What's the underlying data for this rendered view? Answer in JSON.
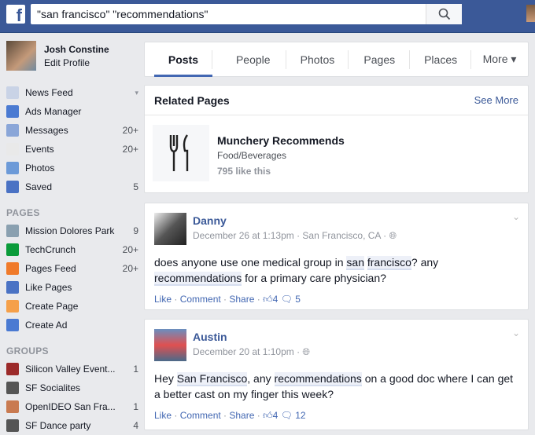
{
  "header": {
    "search_value": "\"san francisco\" \"recommendations\"",
    "logo": "f"
  },
  "profile": {
    "name": "Josh Constine",
    "edit": "Edit Profile"
  },
  "nav": [
    {
      "label": "News Feed",
      "count": "",
      "icon": "news-feed-icon",
      "color": "#c9d3e6"
    },
    {
      "label": "Ads Manager",
      "count": "",
      "icon": "ads-manager-icon",
      "color": "#4a7ad2"
    },
    {
      "label": "Messages",
      "count": "20+",
      "icon": "messages-icon",
      "color": "#8aa6d8"
    },
    {
      "label": "Events",
      "count": "20+",
      "icon": "events-icon",
      "color": "#e9e9e9"
    },
    {
      "label": "Photos",
      "count": "",
      "icon": "photos-icon",
      "color": "#6c9ad8"
    },
    {
      "label": "Saved",
      "count": "5",
      "icon": "saved-icon",
      "color": "#4a72c4"
    }
  ],
  "pages_heading": "PAGES",
  "pages": [
    {
      "label": "Mission Dolores Park",
      "count": "9",
      "color": "#8aa0b0"
    },
    {
      "label": "TechCrunch",
      "count": "20+",
      "color": "#0a9b3a"
    },
    {
      "label": "Pages Feed",
      "count": "20+",
      "color": "#f07a2a"
    },
    {
      "label": "Like Pages",
      "count": "",
      "color": "#4a72c4"
    },
    {
      "label": "Create Page",
      "count": "",
      "color": "#f5a04a"
    },
    {
      "label": "Create Ad",
      "count": "",
      "color": "#4a7ad2"
    }
  ],
  "groups_heading": "GROUPS",
  "groups": [
    {
      "label": "Silicon Valley Event...",
      "count": "1",
      "color": "#9b2a2a"
    },
    {
      "label": "SF Socialites",
      "count": "",
      "color": "#555"
    },
    {
      "label": "OpenIDEO San Fra...",
      "count": "1",
      "color": "#c97a50"
    },
    {
      "label": "SF Dance party",
      "count": "4",
      "color": "#555"
    }
  ],
  "tabs": [
    "Posts",
    "People",
    "Photos",
    "Pages",
    "Places",
    "More ▾"
  ],
  "related": {
    "title": "Related Pages",
    "see_more": "See More",
    "name": "Munchery Recommends",
    "category": "Food/Beverages",
    "likes": "795 like this"
  },
  "posts": [
    {
      "author": "Danny",
      "meta": "December 26 at 1:13pm · San Francisco, CA · ",
      "text": [
        "does anyone use one medical group in ",
        "san",
        " ",
        "francisco",
        "? any ",
        "recommendations",
        " for a primary care physician?"
      ],
      "likes": "4",
      "comments": "5"
    },
    {
      "author": "Austin",
      "meta": "December 20 at 1:10pm · ",
      "text": [
        "Hey ",
        "San Francisco",
        ", any ",
        "recommendations",
        " on a good doc where I can get a better cast on my finger this week?"
      ],
      "likes": "4",
      "comments": "12"
    }
  ],
  "actions": {
    "like": "Like",
    "comment": "Comment",
    "share": "Share",
    "sep": " · "
  }
}
